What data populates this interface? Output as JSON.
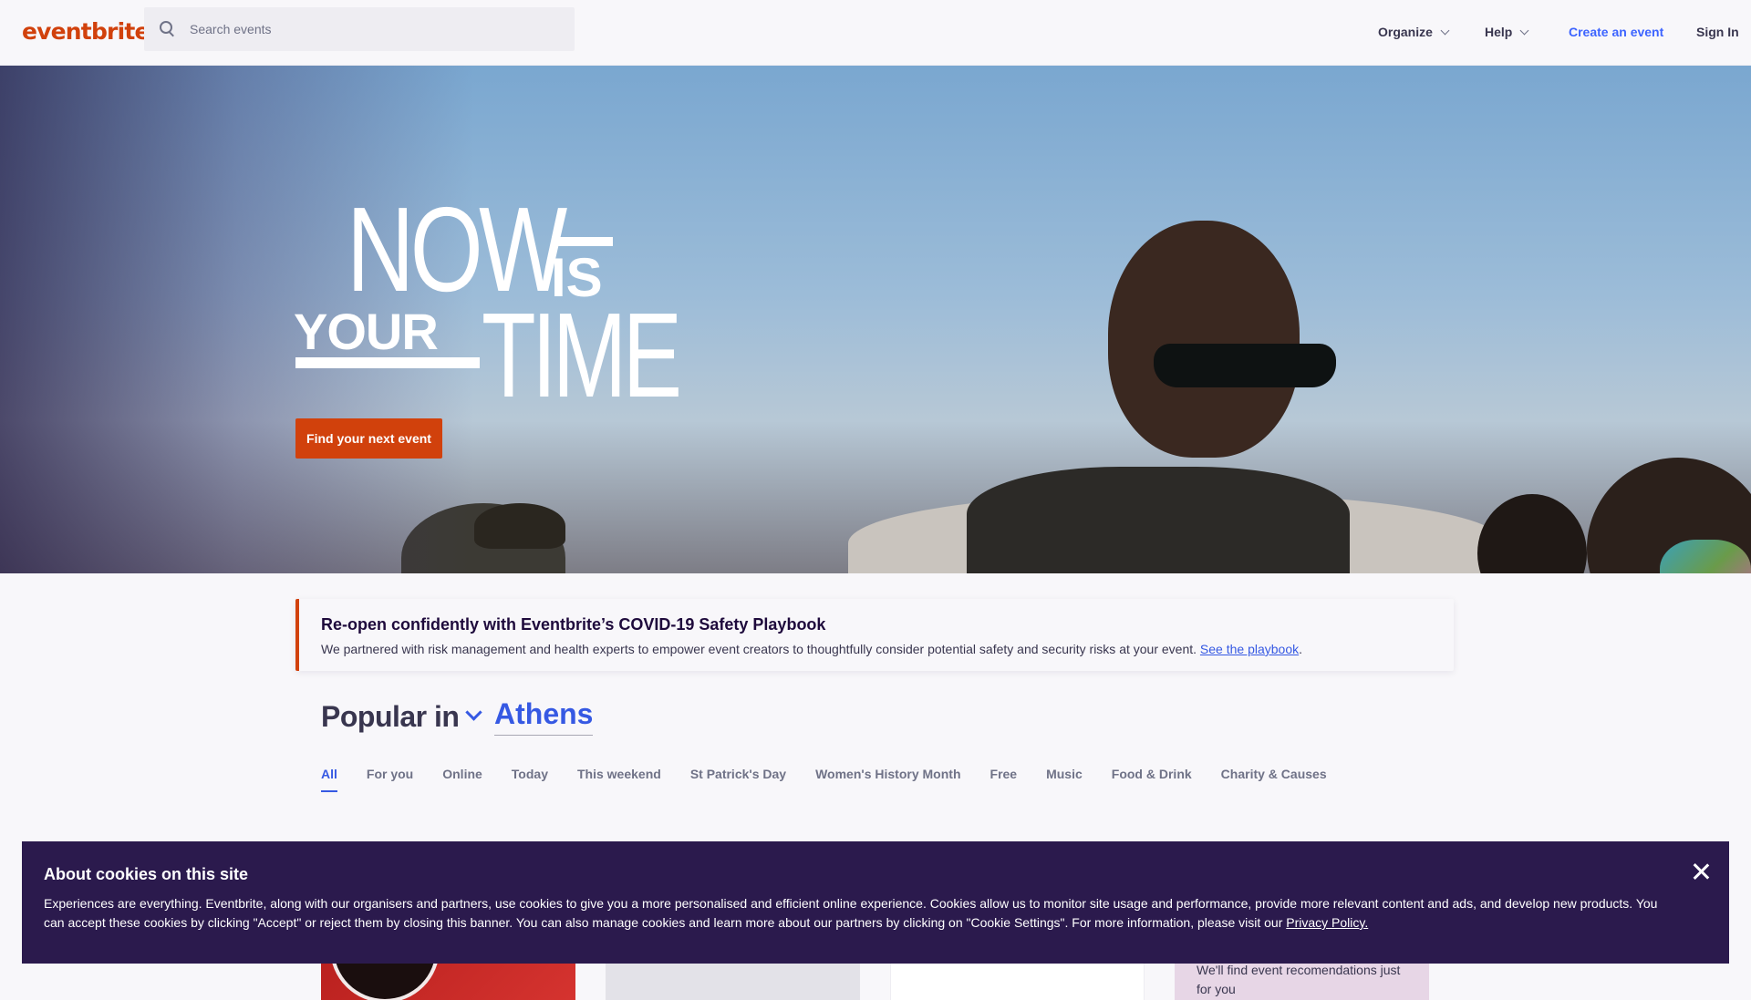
{
  "header": {
    "logo": "eventbrite",
    "search_placeholder": "Search events",
    "nav": {
      "organize": "Organize",
      "help": "Help",
      "create_event": "Create an event",
      "sign_in": "Sign In"
    }
  },
  "hero": {
    "title_now": "NOW",
    "title_is": "IS",
    "title_your": "YOUR",
    "title_time": "TIME",
    "cta": "Find your next event"
  },
  "notice": {
    "title": "Re-open confidently with Eventbrite’s COVID-19 Safety Playbook",
    "body": "We partnered with risk management and health experts to empower event creators to thoughtfully consider potential safety and security risks at your event. ",
    "link": "See the playbook",
    "after_link": "."
  },
  "popular": {
    "label": "Popular in",
    "city": "Athens",
    "tabs": [
      {
        "label": "All",
        "active": true
      },
      {
        "label": "For you"
      },
      {
        "label": "Online"
      },
      {
        "label": "Today"
      },
      {
        "label": "This weekend"
      },
      {
        "label": "St Patrick's Day"
      },
      {
        "label": "Women's History Month"
      },
      {
        "label": "Free"
      },
      {
        "label": "Music"
      },
      {
        "label": "Food & Drink"
      },
      {
        "label": "Charity & Causes"
      }
    ]
  },
  "cards": {
    "recommendation_text": "We'll find event recomendations just for you"
  },
  "cookie": {
    "title": "About cookies on this site",
    "body": "Experiences are everything. Eventbrite, along with our organisers and partners, use cookies to give you a more personalised and efficient online experience. Cookies allow us to monitor site usage and performance, provide more relevant content and ads, and develop new products. You can accept these cookies by clicking \"Accept\" or reject them by closing this banner. You can also manage cookies and learn more about our partners by clicking on \"Cookie Settings\". For more information, please visit our ",
    "link": "Privacy Policy."
  },
  "colors": {
    "brand": "#d1410c",
    "link": "#3659e3",
    "cookie_bg": "#2b1a4d"
  }
}
